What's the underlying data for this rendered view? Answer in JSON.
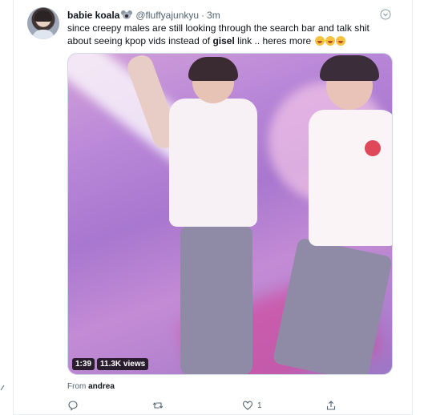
{
  "tweet": {
    "display_name": "babie koala",
    "handle": "@fluffyajunkyu",
    "separator": "·",
    "timestamp": "3m",
    "text_part1": "since creepy males are still looking through the search bar and talk shit about seeing kpop vids instead of ",
    "text_bold": "gisel",
    "text_part2": " link .. heres more",
    "emoji_count": 3,
    "media": {
      "duration": "1:39",
      "views": "11.3K views"
    },
    "source_prefix": "From",
    "source_app": "andrea",
    "actions": {
      "reply_count": "",
      "retweet_count": "",
      "like_count": "1",
      "share_count": ""
    }
  },
  "colors": {
    "text_primary": "#0f1419",
    "text_secondary": "#536471",
    "border": "#e6ecf0"
  },
  "icons": [
    "koala-icon",
    "caret-down-icon",
    "reply-icon",
    "retweet-icon",
    "like-icon",
    "share-icon",
    "face-with-tongue-emoji"
  ]
}
